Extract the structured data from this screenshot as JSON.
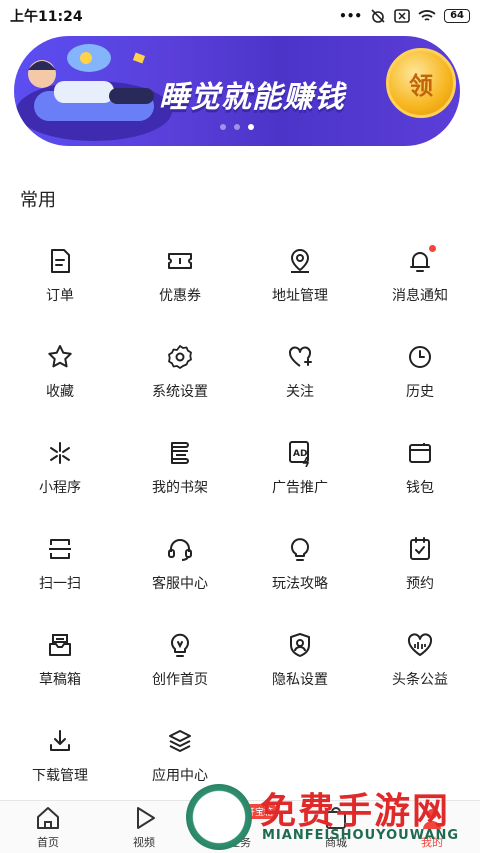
{
  "status": {
    "time": "上午11:24",
    "battery": "64"
  },
  "banner": {
    "title": "睡觉就能赚钱",
    "coin_label": "领"
  },
  "section": {
    "title": "常用"
  },
  "grid": [
    [
      {
        "label": "订单",
        "icon": "document-icon"
      },
      {
        "label": "优惠券",
        "icon": "ticket-icon"
      },
      {
        "label": "地址管理",
        "icon": "location-icon"
      },
      {
        "label": "消息通知",
        "icon": "bell-icon"
      }
    ],
    [
      {
        "label": "收藏",
        "icon": "star-icon"
      },
      {
        "label": "系统设置",
        "icon": "gear-icon"
      },
      {
        "label": "关注",
        "icon": "heart-plus-icon"
      },
      {
        "label": "历史",
        "icon": "clock-icon"
      }
    ],
    [
      {
        "label": "小程序",
        "icon": "miniprogram-icon"
      },
      {
        "label": "我的书架",
        "icon": "bookshelf-icon"
      },
      {
        "label": "广告推广",
        "icon": "ad-icon"
      },
      {
        "label": "钱包",
        "icon": "wallet-icon"
      }
    ],
    [
      {
        "label": "扫一扫",
        "icon": "scan-icon"
      },
      {
        "label": "客服中心",
        "icon": "headset-icon"
      },
      {
        "label": "玩法攻略",
        "icon": "bulb-icon"
      },
      {
        "label": "预约",
        "icon": "calendar-check-icon"
      }
    ],
    [
      {
        "label": "草稿箱",
        "icon": "inbox-icon"
      },
      {
        "label": "创作首页",
        "icon": "lightbulb-pen-icon"
      },
      {
        "label": "隐私设置",
        "icon": "shield-user-icon"
      },
      {
        "label": "头条公益",
        "icon": "charity-icon"
      }
    ],
    [
      {
        "label": "下载管理",
        "icon": "download-icon"
      },
      {
        "label": "应用中心",
        "icon": "layers-icon"
      }
    ]
  ],
  "tabs": [
    {
      "label": "首页",
      "icon": "home-icon"
    },
    {
      "label": "视频",
      "icon": "play-icon"
    },
    {
      "label": "任务",
      "icon": "task-icon"
    },
    {
      "label": "商城",
      "icon": "shop-icon"
    },
    {
      "label": "我的",
      "icon": "user-icon"
    }
  ],
  "task_badge": "开宝箱",
  "watermark": {
    "title": "免费手游网",
    "subtitle": "MIANFEISHOUYOUWANG"
  }
}
